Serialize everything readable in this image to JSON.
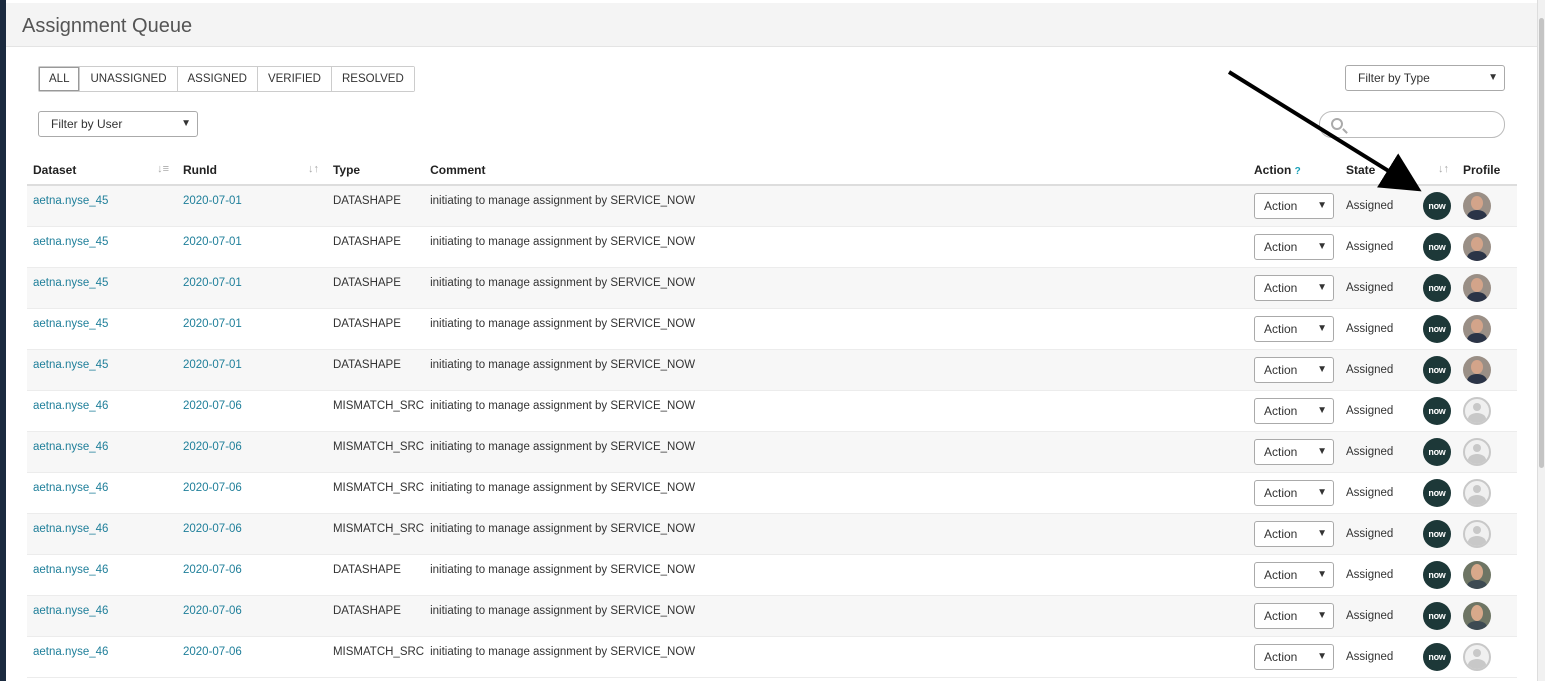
{
  "page": {
    "title": "Assignment Queue"
  },
  "tabs": [
    {
      "label": "ALL",
      "active": true
    },
    {
      "label": "UNASSIGNED",
      "active": false
    },
    {
      "label": "ASSIGNED",
      "active": false
    },
    {
      "label": "VERIFIED",
      "active": false
    },
    {
      "label": "RESOLVED",
      "active": false
    }
  ],
  "filters": {
    "user": "Filter by User",
    "type": "Filter by Type",
    "search_placeholder": ""
  },
  "table": {
    "headers": {
      "dataset": "Dataset",
      "runid": "RunId",
      "type": "Type",
      "comment": "Comment",
      "action": "Action",
      "action_help": "?",
      "state": "State",
      "profile": "Profile"
    },
    "rows": [
      {
        "dataset": "aetna.nyse_45",
        "runid": "2020-07-01",
        "type": "DATASHAPE",
        "comment": "initiating to manage assignment by SERVICE_NOW",
        "action": "Action",
        "state": "Assigned",
        "badge": "now",
        "profile": "photo1"
      },
      {
        "dataset": "aetna.nyse_45",
        "runid": "2020-07-01",
        "type": "DATASHAPE",
        "comment": "initiating to manage assignment by SERVICE_NOW",
        "action": "Action",
        "state": "Assigned",
        "badge": "now",
        "profile": "photo1"
      },
      {
        "dataset": "aetna.nyse_45",
        "runid": "2020-07-01",
        "type": "DATASHAPE",
        "comment": "initiating to manage assignment by SERVICE_NOW",
        "action": "Action",
        "state": "Assigned",
        "badge": "now",
        "profile": "photo1"
      },
      {
        "dataset": "aetna.nyse_45",
        "runid": "2020-07-01",
        "type": "DATASHAPE",
        "comment": "initiating to manage assignment by SERVICE_NOW",
        "action": "Action",
        "state": "Assigned",
        "badge": "now",
        "profile": "photo1"
      },
      {
        "dataset": "aetna.nyse_45",
        "runid": "2020-07-01",
        "type": "DATASHAPE",
        "comment": "initiating to manage assignment by SERVICE_NOW",
        "action": "Action",
        "state": "Assigned",
        "badge": "now",
        "profile": "photo1"
      },
      {
        "dataset": "aetna.nyse_46",
        "runid": "2020-07-06",
        "type": "MISMATCH_SRC",
        "comment": "initiating to manage assignment by SERVICE_NOW",
        "action": "Action",
        "state": "Assigned",
        "badge": "now",
        "profile": "generic"
      },
      {
        "dataset": "aetna.nyse_46",
        "runid": "2020-07-06",
        "type": "MISMATCH_SRC",
        "comment": "initiating to manage assignment by SERVICE_NOW",
        "action": "Action",
        "state": "Assigned",
        "badge": "now",
        "profile": "generic"
      },
      {
        "dataset": "aetna.nyse_46",
        "runid": "2020-07-06",
        "type": "MISMATCH_SRC",
        "comment": "initiating to manage assignment by SERVICE_NOW",
        "action": "Action",
        "state": "Assigned",
        "badge": "now",
        "profile": "generic"
      },
      {
        "dataset": "aetna.nyse_46",
        "runid": "2020-07-06",
        "type": "MISMATCH_SRC",
        "comment": "initiating to manage assignment by SERVICE_NOW",
        "action": "Action",
        "state": "Assigned",
        "badge": "now",
        "profile": "generic"
      },
      {
        "dataset": "aetna.nyse_46",
        "runid": "2020-07-06",
        "type": "DATASHAPE",
        "comment": "initiating to manage assignment by SERVICE_NOW",
        "action": "Action",
        "state": "Assigned",
        "badge": "now",
        "profile": "photo2"
      },
      {
        "dataset": "aetna.nyse_46",
        "runid": "2020-07-06",
        "type": "DATASHAPE",
        "comment": "initiating to manage assignment by SERVICE_NOW",
        "action": "Action",
        "state": "Assigned",
        "badge": "now",
        "profile": "photo2"
      },
      {
        "dataset": "aetna.nyse_46",
        "runid": "2020-07-06",
        "type": "MISMATCH_SRC",
        "comment": "initiating to manage assignment by SERVICE_NOW",
        "action": "Action",
        "state": "Assigned",
        "badge": "now",
        "profile": "generic"
      }
    ]
  },
  "colors": {
    "link": "#1f7f9a",
    "badge_bg": "#1d3838",
    "header_bg": "#f4f4f4",
    "sidebar": "#1b2a3f"
  }
}
